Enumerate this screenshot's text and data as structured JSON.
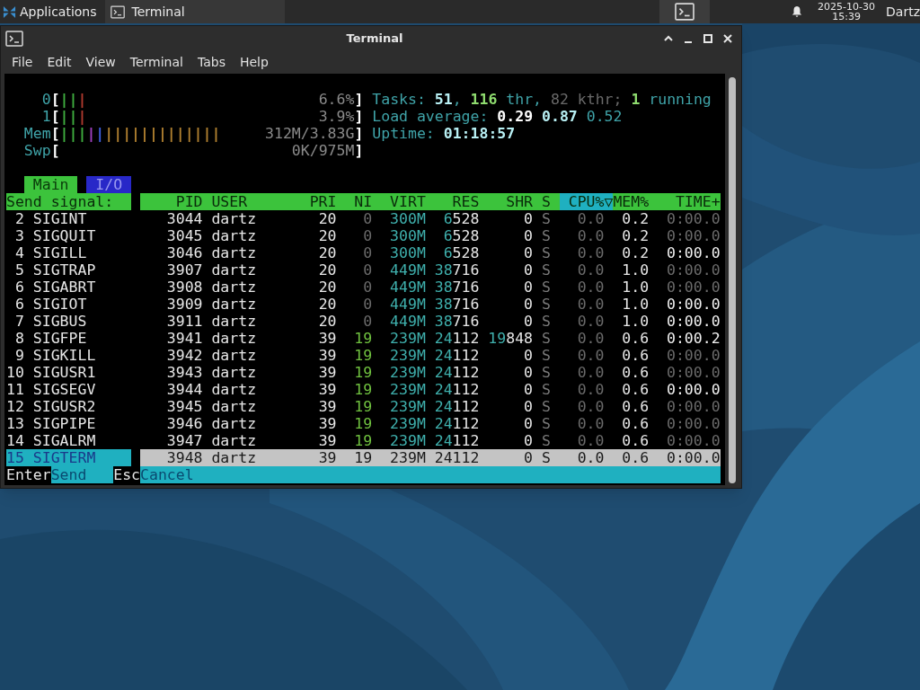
{
  "panel": {
    "menu": "Applications",
    "tasks": [
      {
        "label": "Terminal",
        "selected": false
      }
    ],
    "clock": {
      "date": "2025-10-30",
      "time": "15:39"
    },
    "user": "Dartz"
  },
  "window": {
    "title": "Terminal",
    "menu": [
      "File",
      "Edit",
      "View",
      "Terminal",
      "Tabs",
      "Help"
    ]
  },
  "meters": [
    {
      "label": "0",
      "bracket_open": "[",
      "bracket_close": "]",
      "reading": "6.6%",
      "segments": [
        {
          "color": "#3fae3f",
          "text": "||"
        },
        {
          "color": "#b03a2e",
          "text": "|"
        }
      ]
    },
    {
      "label": "1",
      "bracket_open": "[",
      "bracket_close": "]",
      "reading": "3.9%",
      "segments": [
        {
          "color": "#3fae3f",
          "text": "||"
        },
        {
          "color": "#b03a2e",
          "text": "|"
        }
      ]
    },
    {
      "label": "Mem",
      "bracket_open": "[",
      "bracket_close": "]",
      "reading": "312M/3.83G",
      "segments": [
        {
          "color": "#3fae3f",
          "text": "|||"
        },
        {
          "color": "#a040c0",
          "text": "|"
        },
        {
          "color": "#4060e0",
          "text": "|"
        },
        {
          "color": "#b08030",
          "text": "|||||||||||||"
        }
      ]
    },
    {
      "label": "Swp",
      "bracket_open": "[",
      "bracket_close": "]",
      "reading": "0K/975M"
    }
  ],
  "summary": [
    [
      {
        "text": "Tasks: ",
        "kind": "label"
      },
      {
        "text": "51",
        "kind": "value"
      },
      {
        "text": ", ",
        "kind": "label"
      },
      {
        "text": "116",
        "kind": "green"
      },
      {
        "text": " thr, ",
        "kind": "label"
      },
      {
        "text": "82 kthr; ",
        "kind": "dim"
      },
      {
        "text": "1",
        "kind": "green"
      },
      {
        "text": " running",
        "kind": "label"
      }
    ],
    [
      {
        "text": "Load average: ",
        "kind": "label"
      },
      {
        "text": "0.29",
        "kind": "white"
      },
      {
        "text": " 0.87",
        "kind": "value"
      },
      {
        "text": " 0.52",
        "kind": "label"
      }
    ],
    [
      {
        "text": "Uptime: ",
        "kind": "label"
      },
      {
        "text": "01:18:57",
        "kind": "value"
      }
    ]
  ],
  "tabs": [
    {
      "label": "Main",
      "selected": true
    },
    {
      "label": "I/O",
      "selected": false
    }
  ],
  "signal_panel": {
    "title": "Send signal:",
    "signals": [
      {
        "number": "2",
        "name": "SIGINT",
        "selected": false
      },
      {
        "number": "3",
        "name": "SIGQUIT",
        "selected": false
      },
      {
        "number": "4",
        "name": "SIGILL",
        "selected": false
      },
      {
        "number": "5",
        "name": "SIGTRAP",
        "selected": false
      },
      {
        "number": "6",
        "name": "SIGABRT",
        "selected": false
      },
      {
        "number": "6",
        "name": "SIGIOT",
        "selected": false
      },
      {
        "number": "7",
        "name": "SIGBUS",
        "selected": false
      },
      {
        "number": "8",
        "name": "SIGFPE",
        "selected": false
      },
      {
        "number": "9",
        "name": "SIGKILL",
        "selected": false
      },
      {
        "number": "10",
        "name": "SIGUSR1",
        "selected": false
      },
      {
        "number": "11",
        "name": "SIGSEGV",
        "selected": false
      },
      {
        "number": "12",
        "name": "SIGUSR2",
        "selected": false
      },
      {
        "number": "13",
        "name": "SIGPIPE",
        "selected": false
      },
      {
        "number": "14",
        "name": "SIGALRM",
        "selected": false
      },
      {
        "number": "15",
        "name": "SIGTERM",
        "selected": true
      }
    ]
  },
  "table": {
    "columns": [
      {
        "label": "PID",
        "sorted": false
      },
      {
        "label": "USER",
        "sorted": false
      },
      {
        "label": "PRI",
        "sorted": false
      },
      {
        "label": "NI",
        "sorted": false
      },
      {
        "label": "VIRT",
        "sorted": false
      },
      {
        "label": "RES",
        "sorted": false
      },
      {
        "label": "SHR",
        "sorted": false
      },
      {
        "label": "S",
        "sorted": false
      },
      {
        "label": "CPU%▽",
        "sorted": true
      },
      {
        "label": "MEM%",
        "sorted": false
      },
      {
        "label": "TIME+",
        "sorted": false
      }
    ],
    "rows": [
      {
        "pid": "3044",
        "user": "dartz",
        "pri": "20",
        "ni": "0",
        "niced": false,
        "virt": "300M",
        "res": "6528",
        "shr": "0",
        "s": "S",
        "cpu": "0.0",
        "mem": "0.2",
        "time": "0:00.0",
        "time_bright": false,
        "selected": false
      },
      {
        "pid": "3045",
        "user": "dartz",
        "pri": "20",
        "ni": "0",
        "niced": false,
        "virt": "300M",
        "res": "6528",
        "shr": "0",
        "s": "S",
        "cpu": "0.0",
        "mem": "0.2",
        "time": "0:00.0",
        "time_bright": false,
        "selected": false
      },
      {
        "pid": "3046",
        "user": "dartz",
        "pri": "20",
        "ni": "0",
        "niced": false,
        "virt": "300M",
        "res": "6528",
        "shr": "0",
        "s": "S",
        "cpu": "0.0",
        "mem": "0.2",
        "time": "0:00.0",
        "time_bright": true,
        "selected": false
      },
      {
        "pid": "3907",
        "user": "dartz",
        "pri": "20",
        "ni": "0",
        "niced": false,
        "virt": "449M",
        "res": "38716",
        "shr": "0",
        "s": "S",
        "cpu": "0.0",
        "mem": "1.0",
        "time": "0:00.0",
        "time_bright": false,
        "selected": false
      },
      {
        "pid": "3908",
        "user": "dartz",
        "pri": "20",
        "ni": "0",
        "niced": false,
        "virt": "449M",
        "res": "38716",
        "shr": "0",
        "s": "S",
        "cpu": "0.0",
        "mem": "1.0",
        "time": "0:00.0",
        "time_bright": false,
        "selected": false
      },
      {
        "pid": "3909",
        "user": "dartz",
        "pri": "20",
        "ni": "0",
        "niced": false,
        "virt": "449M",
        "res": "38716",
        "shr": "0",
        "s": "S",
        "cpu": "0.0",
        "mem": "1.0",
        "time": "0:00.0",
        "time_bright": true,
        "selected": false
      },
      {
        "pid": "3911",
        "user": "dartz",
        "pri": "20",
        "ni": "0",
        "niced": false,
        "virt": "449M",
        "res": "38716",
        "shr": "0",
        "s": "S",
        "cpu": "0.0",
        "mem": "1.0",
        "time": "0:00.0",
        "time_bright": true,
        "selected": false
      },
      {
        "pid": "3941",
        "user": "dartz",
        "pri": "39",
        "ni": "19",
        "niced": true,
        "virt": "239M",
        "res": "24112",
        "shr": "19848",
        "s": "S",
        "cpu": "0.0",
        "mem": "0.6",
        "time": "0:00.2",
        "time_bright": true,
        "selected": false
      },
      {
        "pid": "3942",
        "user": "dartz",
        "pri": "39",
        "ni": "19",
        "niced": true,
        "virt": "239M",
        "res": "24112",
        "shr": "0",
        "s": "S",
        "cpu": "0.0",
        "mem": "0.6",
        "time": "0:00.0",
        "time_bright": false,
        "selected": false
      },
      {
        "pid": "3943",
        "user": "dartz",
        "pri": "39",
        "ni": "19",
        "niced": true,
        "virt": "239M",
        "res": "24112",
        "shr": "0",
        "s": "S",
        "cpu": "0.0",
        "mem": "0.6",
        "time": "0:00.0",
        "time_bright": false,
        "selected": false
      },
      {
        "pid": "3944",
        "user": "dartz",
        "pri": "39",
        "ni": "19",
        "niced": true,
        "virt": "239M",
        "res": "24112",
        "shr": "0",
        "s": "S",
        "cpu": "0.0",
        "mem": "0.6",
        "time": "0:00.0",
        "time_bright": true,
        "selected": false
      },
      {
        "pid": "3945",
        "user": "dartz",
        "pri": "39",
        "ni": "19",
        "niced": true,
        "virt": "239M",
        "res": "24112",
        "shr": "0",
        "s": "S",
        "cpu": "0.0",
        "mem": "0.6",
        "time": "0:00.0",
        "time_bright": false,
        "selected": false
      },
      {
        "pid": "3946",
        "user": "dartz",
        "pri": "39",
        "ni": "19",
        "niced": true,
        "virt": "239M",
        "res": "24112",
        "shr": "0",
        "s": "S",
        "cpu": "0.0",
        "mem": "0.6",
        "time": "0:00.0",
        "time_bright": false,
        "selected": false
      },
      {
        "pid": "3947",
        "user": "dartz",
        "pri": "39",
        "ni": "19",
        "niced": true,
        "virt": "239M",
        "res": "24112",
        "shr": "0",
        "s": "S",
        "cpu": "0.0",
        "mem": "0.6",
        "time": "0:00.0",
        "time_bright": false,
        "selected": false
      },
      {
        "pid": "3948",
        "user": "dartz",
        "pri": "39",
        "ni": "19",
        "niced": true,
        "virt": "239M",
        "res": "24112",
        "shr": "0",
        "s": "S",
        "cpu": "0.0",
        "mem": "0.6",
        "time": "0:00.0",
        "time_bright": false,
        "selected": true
      }
    ]
  },
  "function_bar": [
    {
      "key": "Enter",
      "label": "Send"
    },
    {
      "key": "Esc",
      "label": "Cancel"
    }
  ]
}
